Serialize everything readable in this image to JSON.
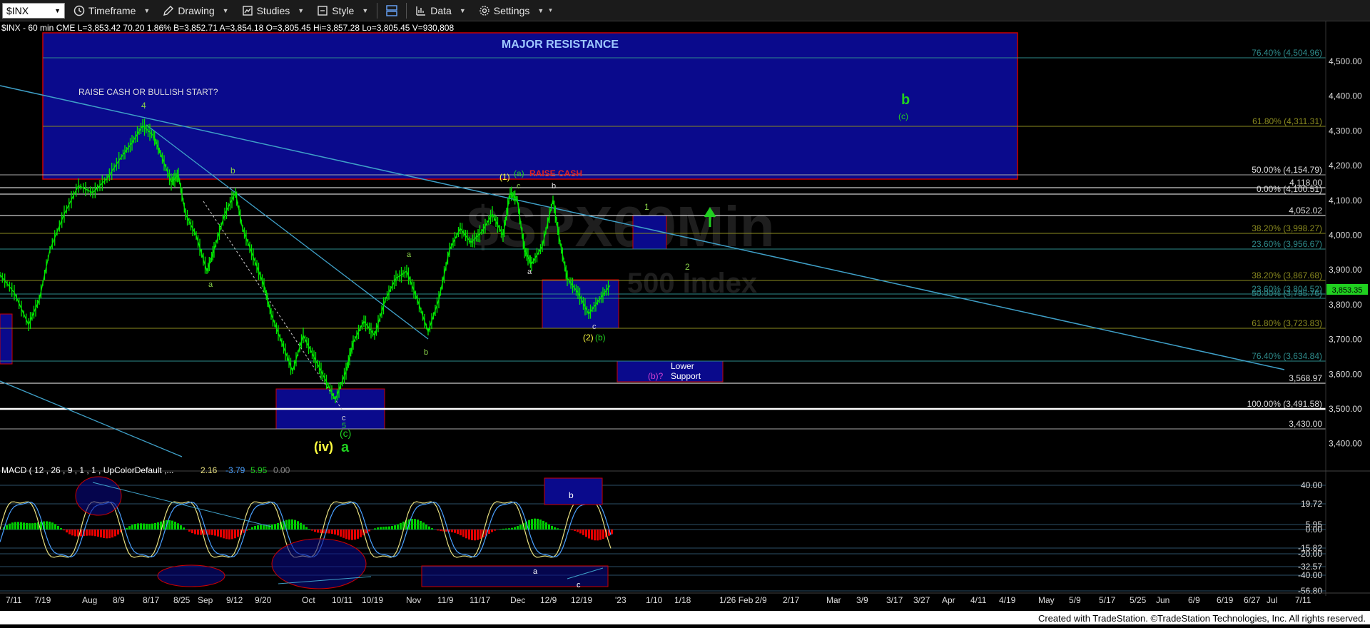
{
  "toolbar": {
    "symbol": "$INX",
    "timeframe": "Timeframe",
    "drawing": "Drawing",
    "studies": "Studies",
    "style": "Style",
    "data": "Data",
    "settings": "Settings"
  },
  "infobar": {
    "symbol_line": "$INX - 60 min  CME  L=3,853.42  70.20  1.86%  B=3,852.71  A=3,854.18  O=3,805.45  Hi=3,857.28  Lo=3,805.45  V=930,808"
  },
  "watermark": {
    "big": "$SPX60Min",
    "small": "500 Index"
  },
  "annotations": {
    "major_resistance": "MAJOR RESISTANCE",
    "raise_cash_q": "RAISE CASH OR BULLISH START?",
    "raise_cash": "RAISE CASH",
    "lower_support_1": "Lower",
    "lower_support_2": "Support",
    "b_q": "(b)?",
    "w4": "4",
    "wb1": "b",
    "wa1": "a",
    "wa2": "a",
    "wb2": "b",
    "wa_main": "a",
    "wiv": "(iv)",
    "wc_main": "(c)",
    "w5": "5",
    "wc_small": "c",
    "w1_paren": "(1)",
    "wa_paren": "(a)",
    "wc2": "c",
    "wb3": "b",
    "wa3": "a",
    "wc3": "c",
    "w2_paren": "(2)",
    "wb_paren": "(b)",
    "w1": "1",
    "w2": "2",
    "big_b": "b",
    "c_paren": "(c)",
    "macd_b": "b",
    "macd_a": "a",
    "macd_c": "c"
  },
  "fib_labels": {
    "f7640top": "76.40% (4,504.96)",
    "f6180top": "61.80% (4,311.31)",
    "f5000a": "50.00% (4,154.79)",
    "f4118": "4,118.00",
    "f0000": "0.00% (4,100.51)",
    "f4052": "4,052.02",
    "f3820a": "38.20% (3,998.27)",
    "f2360a": "23.60% (3,956.67)",
    "f3820b": "38.20% (3,867.68)",
    "f2360b": "23.60% (3,804.52)",
    "f5000b": "50.00% (3,795.76)",
    "f6180b": "61.80% (3,723.83)",
    "f7640b": "76.40% (3,634.84)",
    "f3568": "3,568.97",
    "f10000": "100.00% (3,491.58)",
    "f3430": "3,430.00"
  },
  "price_axis": [
    "4,500.00",
    "4,400.00",
    "4,300.00",
    "4,200.00",
    "4,100.00",
    "4,000.00",
    "3,900.00",
    "3,800.00",
    "3,700.00",
    "3,600.00",
    "3,500.00",
    "3,400.00"
  ],
  "last_price": "3,853.35",
  "macd": {
    "title": "MACD ( 12 , 26 , 9 , 1 , 1 , UpColorDefault ,...",
    "v1": "2.16",
    "v2": "-3.79",
    "v3": "5.95",
    "v4": "0.00",
    "axis": [
      "40.00",
      "19.72",
      "5.95",
      "0.00",
      "-15.82",
      "-20.00",
      "-32.57",
      "-40.00",
      "-56.80"
    ]
  },
  "time_axis": [
    "7/11",
    "7/19",
    "Aug",
    "8/9",
    "8/17",
    "8/25",
    "Sep",
    "9/12",
    "9/20",
    "Oct",
    "10/11",
    "10/19",
    "Nov",
    "11/9",
    "11/17",
    "Dec",
    "12/9",
    "12/19",
    "'23",
    "1/10",
    "1/18",
    "1/26 Feb",
    "2/9",
    "2/17",
    "Mar",
    "3/9",
    "3/17",
    "3/27",
    "Apr",
    "4/11",
    "4/19",
    "May",
    "5/9",
    "5/17",
    "5/25",
    "Jun",
    "6/9",
    "6/19",
    "6/27",
    "Jul",
    "7/11"
  ],
  "credit": "Created with TradeStation. ©TradeStation Technologies, Inc. All rights reserved.",
  "colors": {
    "bar": "#00e600",
    "box": "#0a0a8c",
    "box_border": "#cc0000",
    "fib": "#2e8b8b",
    "trend": "#3fa0c8",
    "macd_pos": "#00cc00",
    "macd_neg": "#e60000"
  }
}
